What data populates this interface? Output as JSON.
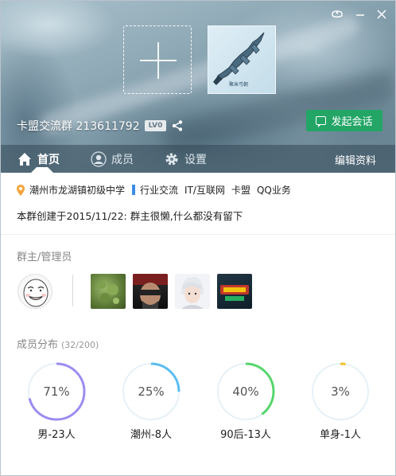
{
  "window": {
    "top_icons": [
      "skin-icon",
      "minimize-icon",
      "close-icon"
    ]
  },
  "header": {
    "group_name": "卡盟交流群 213611792",
    "level_badge": "LV0",
    "chat_button_label": "发起会话",
    "avatar_caption": "聚米弓朝"
  },
  "tabs": [
    {
      "label": "首页",
      "icon": "home-icon",
      "active": true
    },
    {
      "label": "成员",
      "icon": "person-icon",
      "active": false
    },
    {
      "label": "设置",
      "icon": "gear-icon",
      "active": false
    }
  ],
  "edit_label": "编辑资料",
  "tags": {
    "location": "潮州市龙湖镇初级中学",
    "category": "行业交流",
    "keywords": [
      "IT/互联网",
      "卡盟",
      "QQ业务"
    ]
  },
  "description": "本群创建于2015/11/22:  群主很懒,什么都没有留下",
  "admins_section": {
    "title": "群主/管理员"
  },
  "distribution": {
    "title": "成员分布",
    "count": "(32/200)",
    "items": [
      {
        "percent_label": "71%",
        "value": 0.71,
        "label": "男-23人",
        "color": "#9b8df0"
      },
      {
        "percent_label": "25%",
        "value": 0.25,
        "label": "潮州-8人",
        "color": "#5bbdf0"
      },
      {
        "percent_label": "40%",
        "value": 0.4,
        "label": "90后-13人",
        "color": "#55d66b"
      },
      {
        "percent_label": "3%",
        "value": 0.03,
        "label": "单身-1人",
        "color": "#f2c230"
      }
    ]
  }
}
